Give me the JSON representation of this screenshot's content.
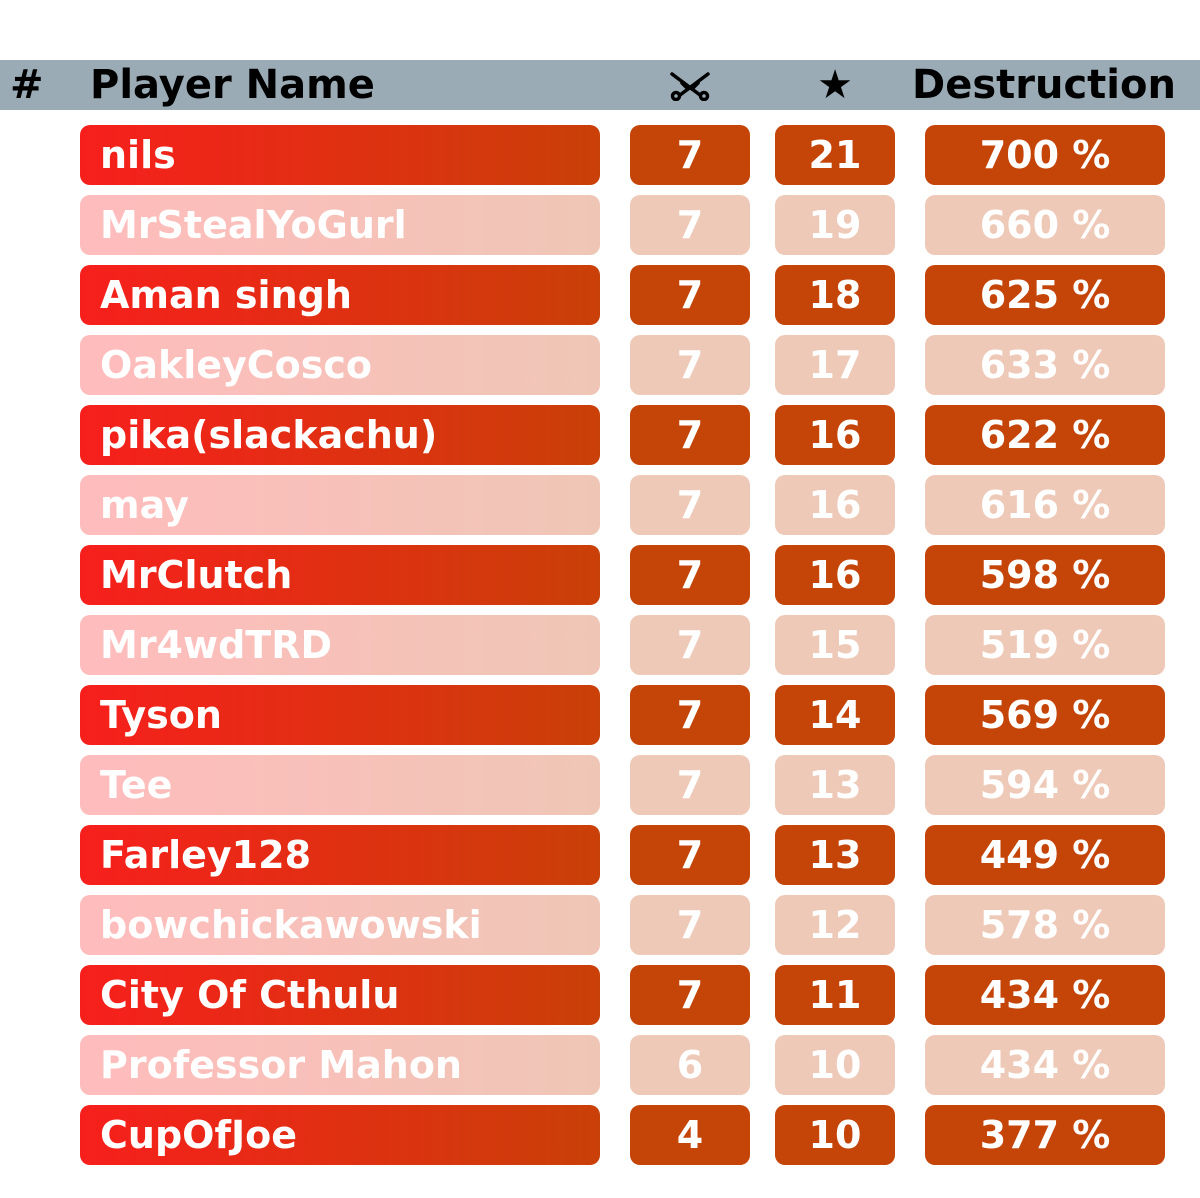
{
  "header": {
    "rank_label": "#",
    "name_label": "Player Name",
    "attacks_icon": "crossed-swords-icon",
    "stars_icon": "star-icon",
    "stars_glyph": "★",
    "destruction_label": "Destruction"
  },
  "colors": {
    "header_bg": "#9aabb5",
    "dark_name_start": "#f71f1c",
    "dark_name_end": "#c94008",
    "dark_cell": "#c54407",
    "light_name_start": "#ffbcbc",
    "light_name_end": "#efc6b6",
    "light_cell": "#efc9b8"
  },
  "rows": [
    {
      "name": "nils",
      "attacks": "7",
      "stars": "21",
      "destruction": "700 %"
    },
    {
      "name": "MrStealYoGurl",
      "attacks": "7",
      "stars": "19",
      "destruction": "660 %"
    },
    {
      "name": "Aman singh",
      "attacks": "7",
      "stars": "18",
      "destruction": "625 %"
    },
    {
      "name": "OakleyCosco",
      "attacks": "7",
      "stars": "17",
      "destruction": "633 %"
    },
    {
      "name": "pika(slackachu)",
      "attacks": "7",
      "stars": "16",
      "destruction": "622 %"
    },
    {
      "name": "may",
      "attacks": "7",
      "stars": "16",
      "destruction": "616 %"
    },
    {
      "name": "MrClutch",
      "attacks": "7",
      "stars": "16",
      "destruction": "598 %"
    },
    {
      "name": "Mr4wdTRD",
      "attacks": "7",
      "stars": "15",
      "destruction": "519 %"
    },
    {
      "name": "Tyson",
      "attacks": "7",
      "stars": "14",
      "destruction": "569 %"
    },
    {
      "name": "Tee",
      "attacks": "7",
      "stars": "13",
      "destruction": "594 %"
    },
    {
      "name": "Farley128",
      "attacks": "7",
      "stars": "13",
      "destruction": "449 %"
    },
    {
      "name": "bowchickawowski",
      "attacks": "7",
      "stars": "12",
      "destruction": "578 %"
    },
    {
      "name": "City Of Cthulu",
      "attacks": "7",
      "stars": "11",
      "destruction": "434 %"
    },
    {
      "name": "Professor Mahon",
      "attacks": "6",
      "stars": "10",
      "destruction": "434 %"
    },
    {
      "name": "CupOfJoe",
      "attacks": "4",
      "stars": "10",
      "destruction": "377 %"
    }
  ]
}
